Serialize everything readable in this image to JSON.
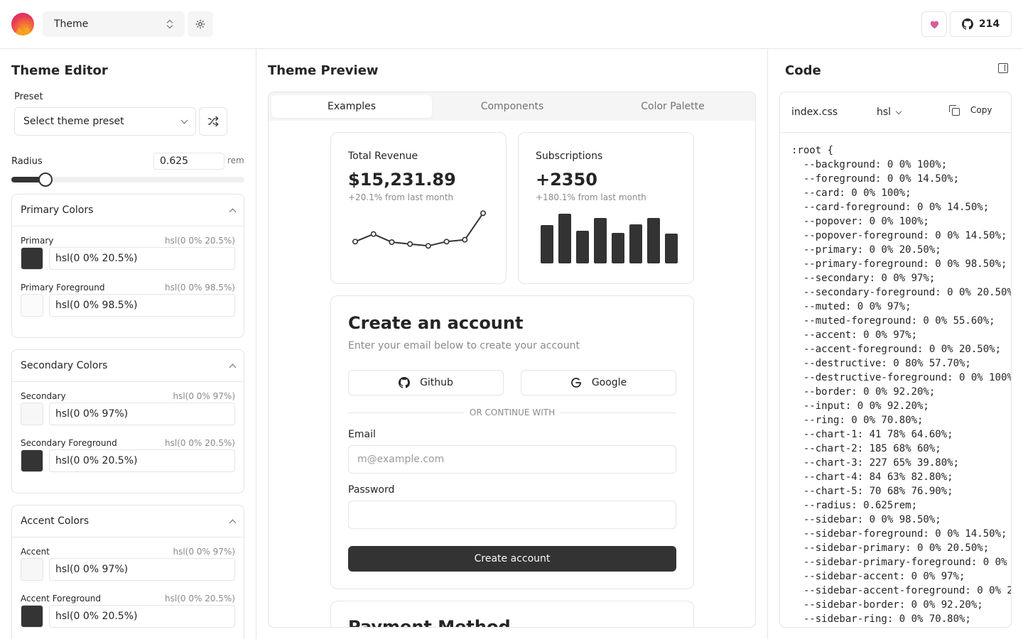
{
  "header": {
    "theme_select_label": "Theme",
    "github_stars": "214",
    "accent_pink": "#d95c9b"
  },
  "editor": {
    "title": "Theme Editor",
    "preset_label": "Preset",
    "preset_placeholder": "Select theme preset",
    "radius_label": "Radius",
    "radius_value": "0.625",
    "radius_unit": "rem",
    "radius_slider_fraction": 0.145,
    "sections": [
      {
        "title": "Primary Colors",
        "colors": [
          {
            "name": "Primary",
            "value": "hsl(0 0% 20.5%)",
            "swatch": "#343434"
          },
          {
            "name": "Primary Foreground",
            "value": "hsl(0 0% 98.5%)",
            "swatch": "#fbfbfb"
          }
        ]
      },
      {
        "title": "Secondary Colors",
        "colors": [
          {
            "name": "Secondary",
            "value": "hsl(0 0% 97%)",
            "swatch": "#f7f7f7"
          },
          {
            "name": "Secondary Foreground",
            "value": "hsl(0 0% 20.5%)",
            "swatch": "#343434"
          }
        ]
      },
      {
        "title": "Accent Colors",
        "colors": [
          {
            "name": "Accent",
            "value": "hsl(0 0% 97%)",
            "swatch": "#f7f7f7"
          },
          {
            "name": "Accent Foreground",
            "value": "hsl(0 0% 20.5%)",
            "swatch": "#343434"
          }
        ]
      }
    ]
  },
  "preview": {
    "title": "Theme Preview",
    "tabs": [
      {
        "label": "Examples",
        "active": true
      },
      {
        "label": "Components",
        "active": false
      },
      {
        "label": "Color Palette",
        "active": false
      }
    ],
    "revenue_card": {
      "title": "Total Revenue",
      "value": "$15,231.89",
      "sub": "+20.1% from last month"
    },
    "subscriptions_card": {
      "title": "Subscriptions",
      "value": "+2350",
      "sub": "+180.1% from last month"
    },
    "account": {
      "title": "Create an account",
      "subtitle": "Enter your email below to create your account",
      "github_label": "Github",
      "google_label": "Google",
      "divider": "OR CONTINUE WITH",
      "email_label": "Email",
      "email_placeholder": "m@example.com",
      "password_label": "Password",
      "submit_label": "Create account"
    },
    "payment_title": "Payment Method"
  },
  "chart_data": [
    {
      "type": "line",
      "x": [
        1,
        2,
        3,
        4,
        5,
        6,
        7,
        8
      ],
      "values": [
        10,
        26,
        9,
        5,
        1,
        10,
        14,
        70
      ],
      "ylim": [
        0,
        75
      ],
      "grid": false
    },
    {
      "type": "bar",
      "categories": [
        "1",
        "2",
        "3",
        "4",
        "5",
        "6",
        "7",
        "8"
      ],
      "values": [
        54,
        70,
        46,
        64,
        43,
        55,
        64,
        42
      ],
      "ylim": [
        0,
        70
      ],
      "grid": false
    }
  ],
  "code": {
    "title": "Code",
    "filename": "index.css",
    "format": "hsl",
    "copy_label": "Copy",
    "lines": [
      ":root {",
      "  --background: 0 0% 100%;",
      "  --foreground: 0 0% 14.50%;",
      "  --card: 0 0% 100%;",
      "  --card-foreground: 0 0% 14.50%;",
      "  --popover: 0 0% 100%;",
      "  --popover-foreground: 0 0% 14.50%;",
      "  --primary: 0 0% 20.50%;",
      "  --primary-foreground: 0 0% 98.50%;",
      "  --secondary: 0 0% 97%;",
      "  --secondary-foreground: 0 0% 20.50%",
      "  --muted: 0 0% 97%;",
      "  --muted-foreground: 0 0% 55.60%;",
      "  --accent: 0 0% 97%;",
      "  --accent-foreground: 0 0% 20.50%;",
      "  --destructive: 0 80% 57.70%;",
      "  --destructive-foreground: 0 0% 100%",
      "  --border: 0 0% 92.20%;",
      "  --input: 0 0% 92.20%;",
      "  --ring: 0 0% 70.80%;",
      "  --chart-1: 41 78% 64.60%;",
      "  --chart-2: 185 68% 60%;",
      "  --chart-3: 227 65% 39.80%;",
      "  --chart-4: 84 63% 82.80%;",
      "  --chart-5: 70 68% 76.90%;",
      "  --radius: 0.625rem;",
      "  --sidebar: 0 0% 98.50%;",
      "  --sidebar-foreground: 0 0% 14.50%;",
      "  --sidebar-primary: 0 0% 20.50%;",
      "  --sidebar-primary-foreground: 0 0%",
      "  --sidebar-accent: 0 0% 97%;",
      "  --sidebar-accent-foreground: 0 0% 2",
      "  --sidebar-border: 0 0% 92.20%;",
      "  --sidebar-ring: 0 0% 70.80%;"
    ]
  }
}
